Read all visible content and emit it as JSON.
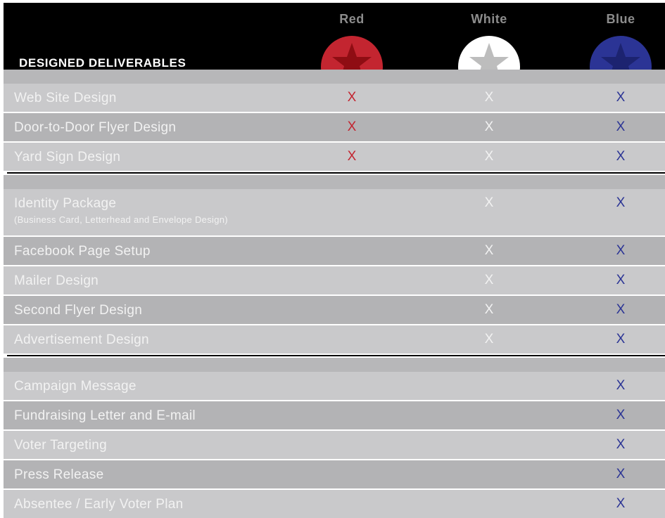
{
  "header": {
    "title": "DESIGNED DELIVERABLES"
  },
  "tiers": [
    {
      "name": "Red",
      "color": "#c32530",
      "star_color": "#8f0d13",
      "icon": "star-icon"
    },
    {
      "name": "White",
      "color": "#ffffff",
      "star_color": "#bdbdbd",
      "icon": "star-icon"
    },
    {
      "name": "Blue",
      "color": "#2b3495",
      "star_color": "#1c2370",
      "icon": "star-icon"
    }
  ],
  "mark_symbol": "X",
  "groups": [
    {
      "rows": [
        {
          "label": "Web Site Design",
          "red": true,
          "white": true,
          "blue": true
        },
        {
          "label": "Door-to-Door Flyer Design",
          "red": true,
          "white": true,
          "blue": true
        },
        {
          "label": "Yard Sign Design",
          "red": true,
          "white": true,
          "blue": true
        }
      ]
    },
    {
      "rows": [
        {
          "label": "Identity Package",
          "sublabel": "(Business Card, Letterhead and Envelope Design)",
          "red": false,
          "white": true,
          "blue": true
        },
        {
          "label": "Facebook Page Setup",
          "red": false,
          "white": true,
          "blue": true
        },
        {
          "label": "Mailer Design",
          "red": false,
          "white": true,
          "blue": true
        },
        {
          "label": "Second Flyer Design",
          "red": false,
          "white": true,
          "blue": true
        },
        {
          "label": "Advertisement Design",
          "red": false,
          "white": true,
          "blue": true
        }
      ]
    },
    {
      "rows": [
        {
          "label": "Campaign Message",
          "red": false,
          "white": false,
          "blue": true
        },
        {
          "label": "Fundraising Letter and E-mail",
          "red": false,
          "white": false,
          "blue": true
        },
        {
          "label": "Voter Targeting",
          "red": false,
          "white": false,
          "blue": true
        },
        {
          "label": "Press Release",
          "red": false,
          "white": false,
          "blue": true
        },
        {
          "label": "Absentee / Early Voter Plan",
          "red": false,
          "white": false,
          "blue": true
        }
      ]
    }
  ]
}
